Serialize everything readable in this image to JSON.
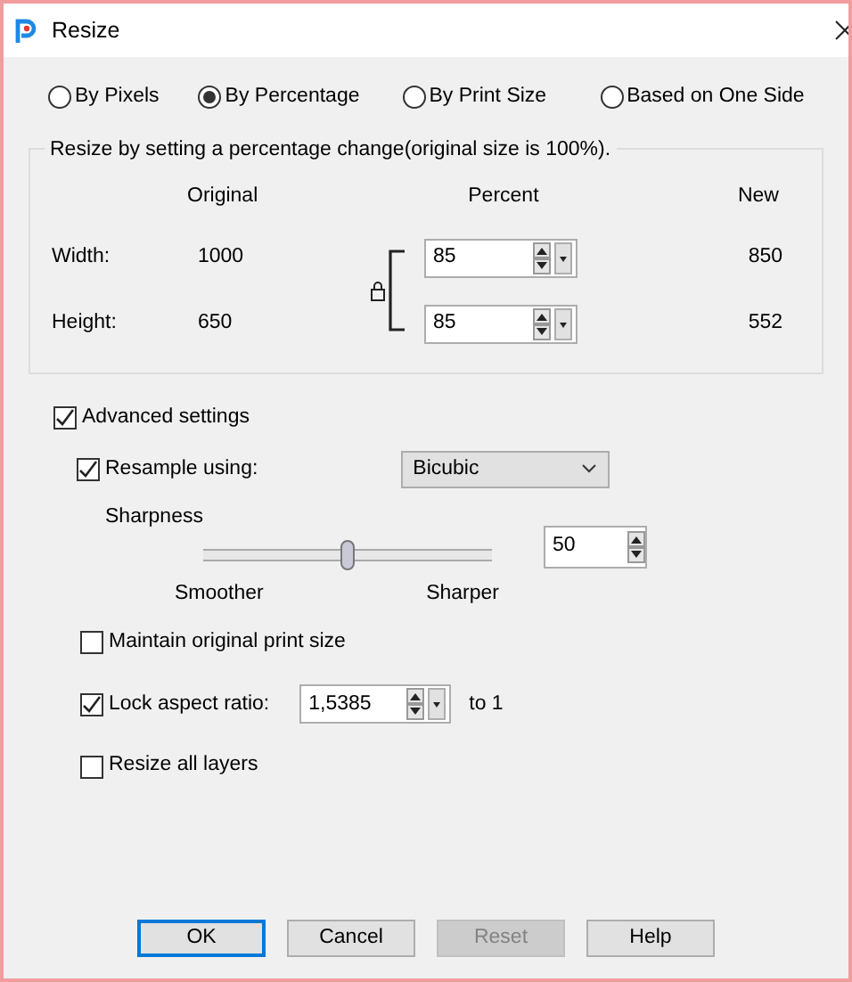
{
  "window": {
    "title": "Resize"
  },
  "resize_modes": [
    {
      "label": "By Pixels",
      "selected": false
    },
    {
      "label": "By Percentage",
      "selected": true
    },
    {
      "label": "By Print Size",
      "selected": false
    },
    {
      "label": "Based on One Side",
      "selected": false
    }
  ],
  "group": {
    "caption": "Resize by setting a percentage change(original size is 100%).",
    "columns": [
      "Original",
      "Percent",
      "New"
    ],
    "rows": [
      {
        "label": "Width:",
        "original": "1000",
        "percent": "85",
        "new": "850"
      },
      {
        "label": "Height:",
        "original": "650",
        "percent": "85",
        "new": "552"
      }
    ]
  },
  "advanced": {
    "label": "Advanced settings",
    "checked": true
  },
  "resample": {
    "label": "Resample using:",
    "checked": true,
    "method": "Bicubic"
  },
  "sharpness": {
    "label": "Sharpness",
    "level": 0.5,
    "min_label": "Smoother",
    "max_label": "Sharper",
    "value": "50"
  },
  "options": [
    {
      "kind": "check",
      "label": "Maintain original print size",
      "checked": false
    },
    {
      "kind": "ratio",
      "label": "Lock aspect ratio:",
      "checked": true,
      "value": "1,5385",
      "suffix": "to 1"
    },
    {
      "kind": "check",
      "label": "Resize all layers",
      "checked": false
    }
  ],
  "buttons": [
    {
      "label": "OK",
      "default": true,
      "disabled": false
    },
    {
      "label": "Cancel",
      "default": false,
      "disabled": false
    },
    {
      "label": "Reset",
      "default": false,
      "disabled": true
    },
    {
      "label": "Help",
      "default": false,
      "disabled": false
    }
  ]
}
